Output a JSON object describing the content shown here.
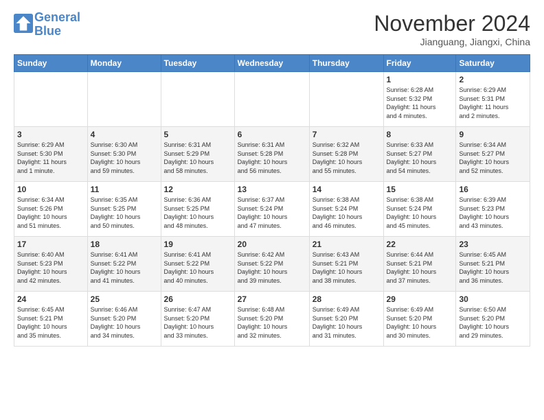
{
  "header": {
    "logo_line1": "General",
    "logo_line2": "Blue",
    "month": "November 2024",
    "location": "Jianguang, Jiangxi, China"
  },
  "weekdays": [
    "Sunday",
    "Monday",
    "Tuesday",
    "Wednesday",
    "Thursday",
    "Friday",
    "Saturday"
  ],
  "weeks": [
    [
      {
        "day": "",
        "info": ""
      },
      {
        "day": "",
        "info": ""
      },
      {
        "day": "",
        "info": ""
      },
      {
        "day": "",
        "info": ""
      },
      {
        "day": "",
        "info": ""
      },
      {
        "day": "1",
        "info": "Sunrise: 6:28 AM\nSunset: 5:32 PM\nDaylight: 11 hours\nand 4 minutes."
      },
      {
        "day": "2",
        "info": "Sunrise: 6:29 AM\nSunset: 5:31 PM\nDaylight: 11 hours\nand 2 minutes."
      }
    ],
    [
      {
        "day": "3",
        "info": "Sunrise: 6:29 AM\nSunset: 5:30 PM\nDaylight: 11 hours\nand 1 minute."
      },
      {
        "day": "4",
        "info": "Sunrise: 6:30 AM\nSunset: 5:30 PM\nDaylight: 10 hours\nand 59 minutes."
      },
      {
        "day": "5",
        "info": "Sunrise: 6:31 AM\nSunset: 5:29 PM\nDaylight: 10 hours\nand 58 minutes."
      },
      {
        "day": "6",
        "info": "Sunrise: 6:31 AM\nSunset: 5:28 PM\nDaylight: 10 hours\nand 56 minutes."
      },
      {
        "day": "7",
        "info": "Sunrise: 6:32 AM\nSunset: 5:28 PM\nDaylight: 10 hours\nand 55 minutes."
      },
      {
        "day": "8",
        "info": "Sunrise: 6:33 AM\nSunset: 5:27 PM\nDaylight: 10 hours\nand 54 minutes."
      },
      {
        "day": "9",
        "info": "Sunrise: 6:34 AM\nSunset: 5:27 PM\nDaylight: 10 hours\nand 52 minutes."
      }
    ],
    [
      {
        "day": "10",
        "info": "Sunrise: 6:34 AM\nSunset: 5:26 PM\nDaylight: 10 hours\nand 51 minutes."
      },
      {
        "day": "11",
        "info": "Sunrise: 6:35 AM\nSunset: 5:25 PM\nDaylight: 10 hours\nand 50 minutes."
      },
      {
        "day": "12",
        "info": "Sunrise: 6:36 AM\nSunset: 5:25 PM\nDaylight: 10 hours\nand 48 minutes."
      },
      {
        "day": "13",
        "info": "Sunrise: 6:37 AM\nSunset: 5:24 PM\nDaylight: 10 hours\nand 47 minutes."
      },
      {
        "day": "14",
        "info": "Sunrise: 6:38 AM\nSunset: 5:24 PM\nDaylight: 10 hours\nand 46 minutes."
      },
      {
        "day": "15",
        "info": "Sunrise: 6:38 AM\nSunset: 5:24 PM\nDaylight: 10 hours\nand 45 minutes."
      },
      {
        "day": "16",
        "info": "Sunrise: 6:39 AM\nSunset: 5:23 PM\nDaylight: 10 hours\nand 43 minutes."
      }
    ],
    [
      {
        "day": "17",
        "info": "Sunrise: 6:40 AM\nSunset: 5:23 PM\nDaylight: 10 hours\nand 42 minutes."
      },
      {
        "day": "18",
        "info": "Sunrise: 6:41 AM\nSunset: 5:22 PM\nDaylight: 10 hours\nand 41 minutes."
      },
      {
        "day": "19",
        "info": "Sunrise: 6:41 AM\nSunset: 5:22 PM\nDaylight: 10 hours\nand 40 minutes."
      },
      {
        "day": "20",
        "info": "Sunrise: 6:42 AM\nSunset: 5:22 PM\nDaylight: 10 hours\nand 39 minutes."
      },
      {
        "day": "21",
        "info": "Sunrise: 6:43 AM\nSunset: 5:21 PM\nDaylight: 10 hours\nand 38 minutes."
      },
      {
        "day": "22",
        "info": "Sunrise: 6:44 AM\nSunset: 5:21 PM\nDaylight: 10 hours\nand 37 minutes."
      },
      {
        "day": "23",
        "info": "Sunrise: 6:45 AM\nSunset: 5:21 PM\nDaylight: 10 hours\nand 36 minutes."
      }
    ],
    [
      {
        "day": "24",
        "info": "Sunrise: 6:45 AM\nSunset: 5:21 PM\nDaylight: 10 hours\nand 35 minutes."
      },
      {
        "day": "25",
        "info": "Sunrise: 6:46 AM\nSunset: 5:20 PM\nDaylight: 10 hours\nand 34 minutes."
      },
      {
        "day": "26",
        "info": "Sunrise: 6:47 AM\nSunset: 5:20 PM\nDaylight: 10 hours\nand 33 minutes."
      },
      {
        "day": "27",
        "info": "Sunrise: 6:48 AM\nSunset: 5:20 PM\nDaylight: 10 hours\nand 32 minutes."
      },
      {
        "day": "28",
        "info": "Sunrise: 6:49 AM\nSunset: 5:20 PM\nDaylight: 10 hours\nand 31 minutes."
      },
      {
        "day": "29",
        "info": "Sunrise: 6:49 AM\nSunset: 5:20 PM\nDaylight: 10 hours\nand 30 minutes."
      },
      {
        "day": "30",
        "info": "Sunrise: 6:50 AM\nSunset: 5:20 PM\nDaylight: 10 hours\nand 29 minutes."
      }
    ]
  ]
}
